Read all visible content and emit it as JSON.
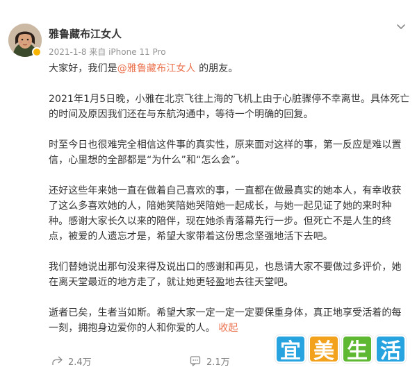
{
  "post": {
    "author": "雅鲁藏布江女人",
    "meta": "2021-1-8  来自 iPhone 11 Pro"
  },
  "content": {
    "greeting_prefix": "大家好，我们是",
    "mention": "@雅鲁藏布江女人",
    "greeting_suffix": " 的朋友。",
    "p2": "2021年1月5日晚，小雅在北京飞往上海的飞机上由于心脏骤停不幸离世。具体死亡的时间及原因我们还在与东航沟通中，等待一个明确的回复。",
    "p3": "时至今日也很难完全相信这件事的真实性，原来面对这样的事，第一反应是难以置信，心里想的全部都是“为什么”和“怎么会”。",
    "p4": "还好这些年来她一直在做着自己喜欢的事，一直都在做最真实的她本人，有幸收获了这么多喜欢她的人，陪她笑陪她哭陪她一起成长，与她一起见证了她的来时种种。感谢大家长久以来的陪伴，现在她杀青落幕先行一步。但死亡不是人生的终点，被爱的人遗忘才是，希望大家带着这份思念坚强地活下去吧。",
    "p5": "我们替她说出那句没来得及说出口的感谢和再见，也恳请大家不要做过多评价，她在离天堂最近的地方走了，就让她更轻盈地去往天堂吧。",
    "p6": "逝者已矣，生者当如斯。希望大家一定一定一定要保重身体，真正地享受活着的每一刻，拥抱身边爱你的人和你爱的人。",
    "collapse_label": "收起"
  },
  "watermark": {
    "chars": [
      "宜",
      "美",
      "生",
      "活"
    ],
    "colors": [
      "#27a4e0",
      "#f2a21c",
      "#5fb832",
      "#27a4e0"
    ]
  },
  "footer": {
    "repost_count": "2.4万",
    "comment_count": "2.1万"
  },
  "icons": {
    "menu": "chevron-down-icon",
    "repost": "share-icon",
    "comment": "comment-icon",
    "verified": "verified-badge-icon"
  },
  "colors": {
    "mention": "#eb7350",
    "meta": "#939393",
    "badge": "#f7b500"
  }
}
